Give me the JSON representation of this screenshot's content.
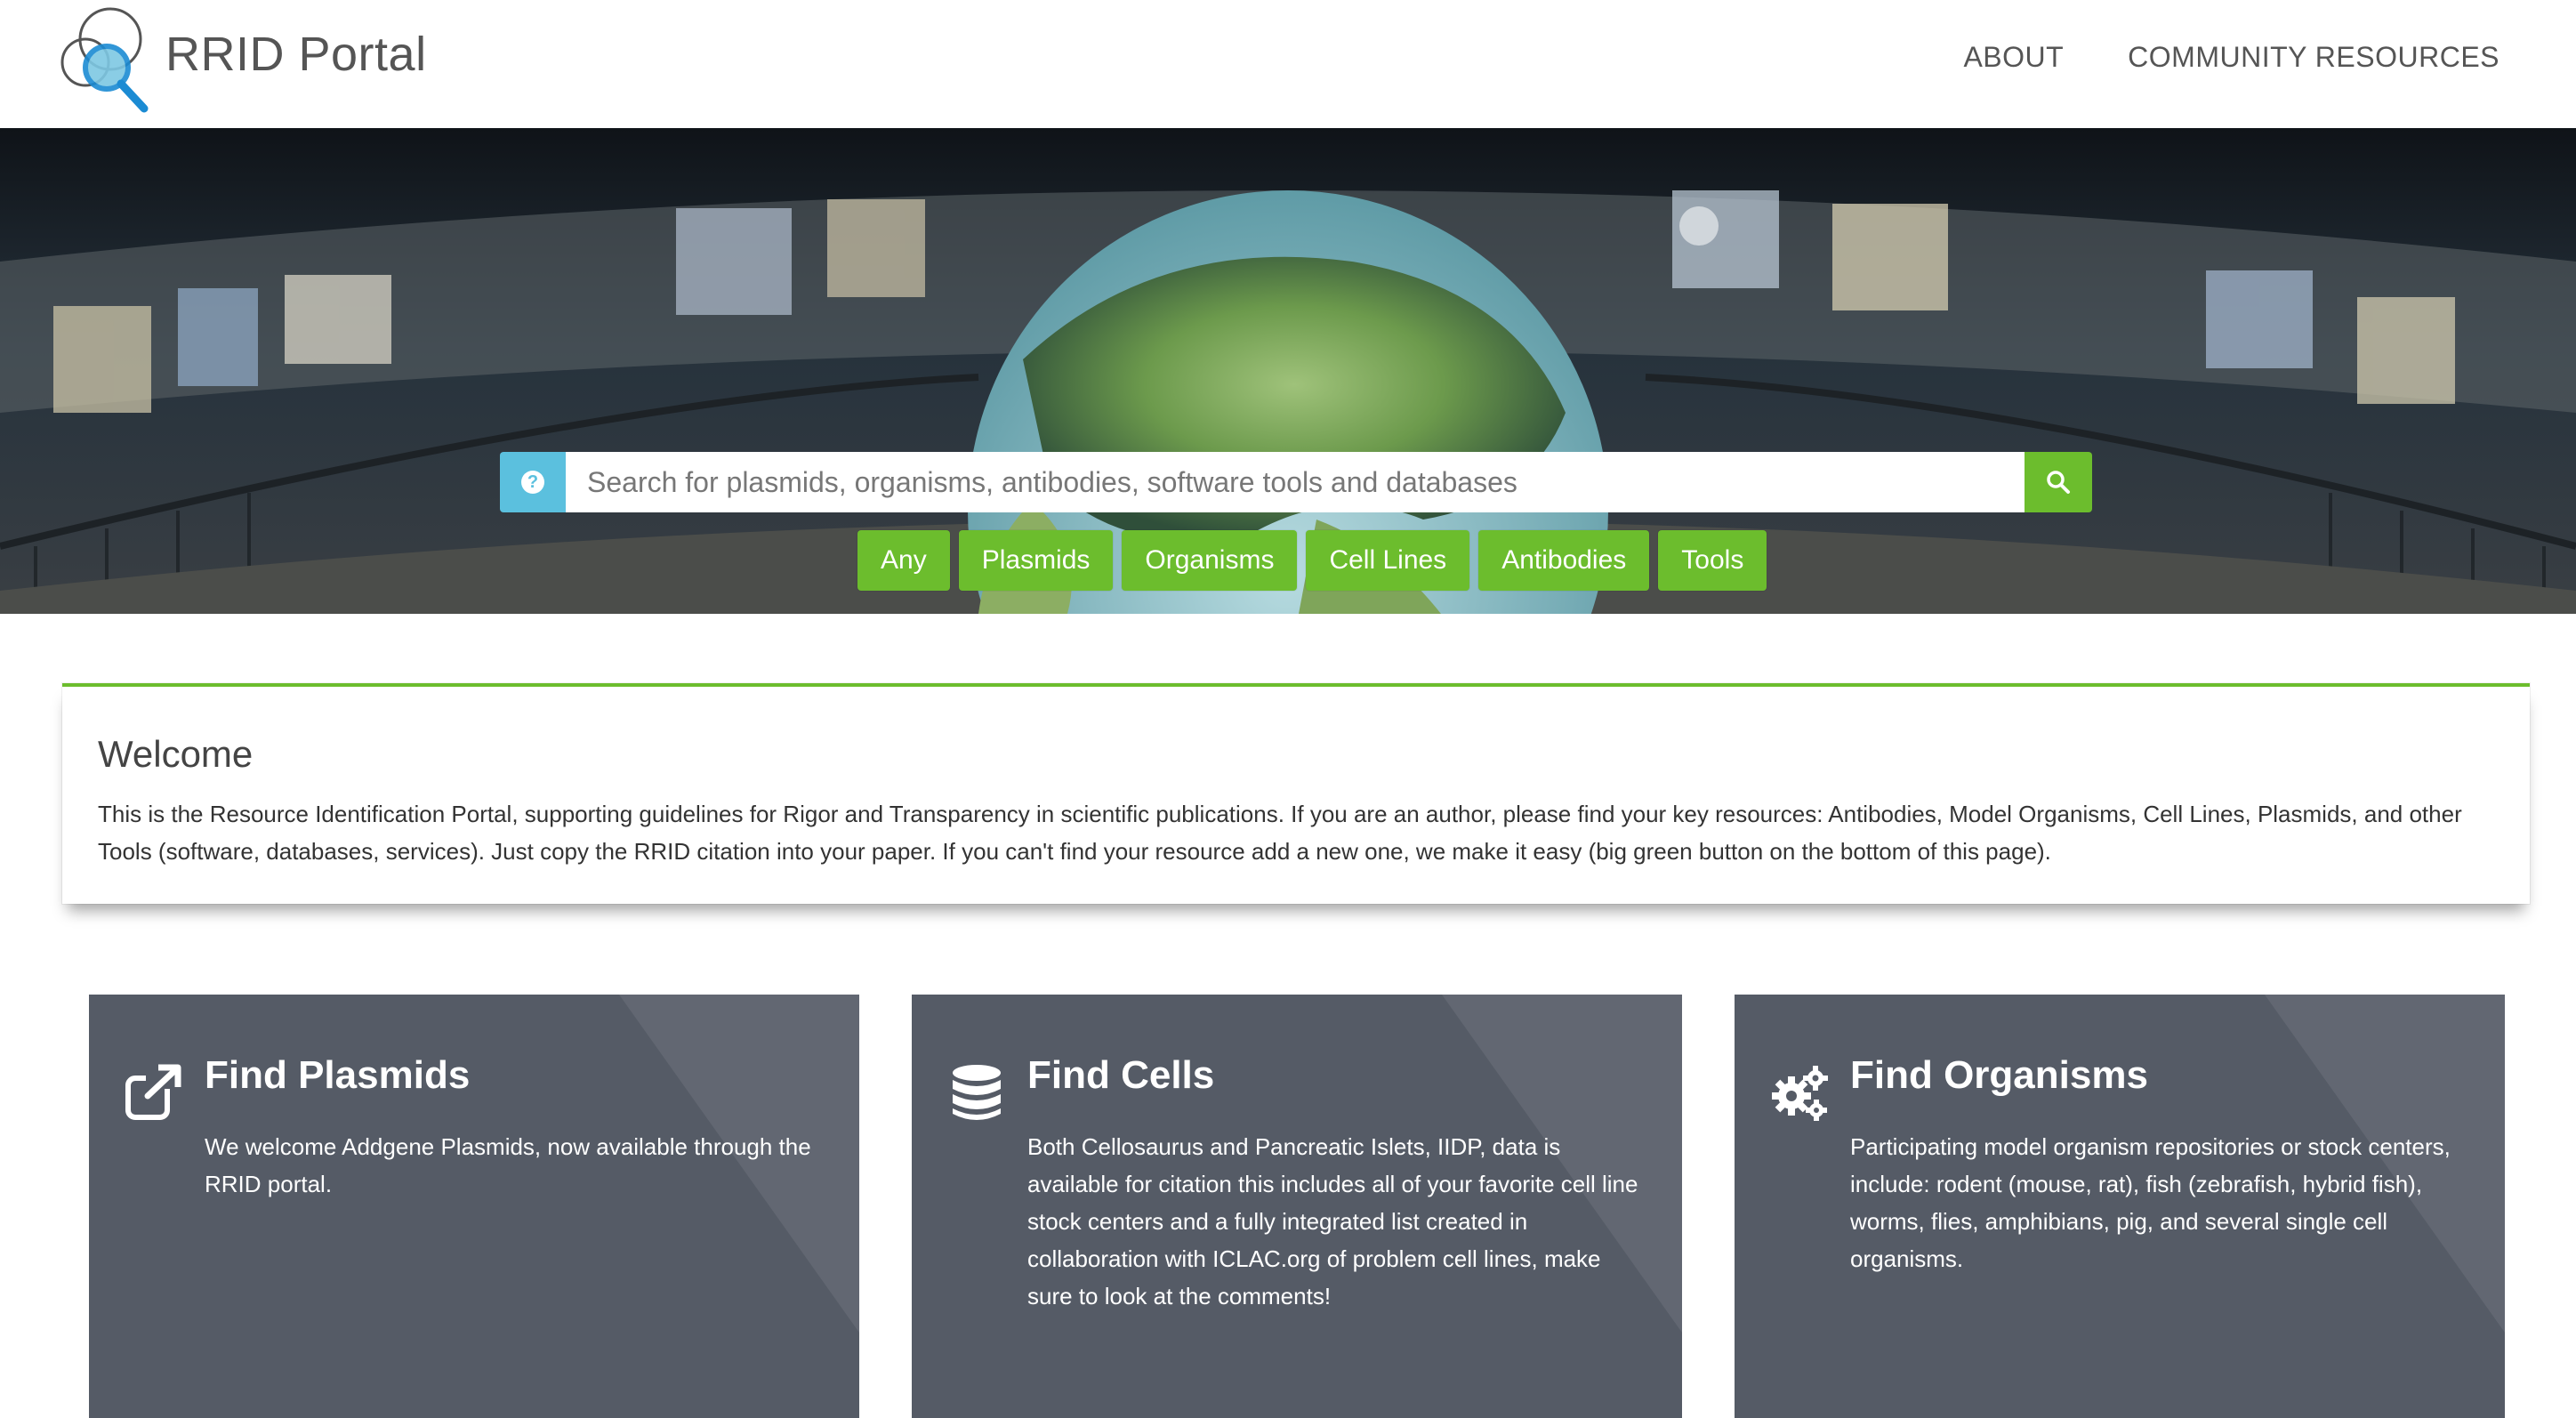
{
  "header": {
    "brand": "RRID Portal",
    "nav": [
      "ABOUT",
      "COMMUNITY RESOURCES"
    ]
  },
  "search": {
    "placeholder": "Search for plasmids, organisms, antibodies, software tools and databases",
    "help_icon": "question-circle-icon",
    "submit_icon": "search-icon",
    "filters": [
      "Any",
      "Plasmids",
      "Organisms",
      "Cell Lines",
      "Antibodies",
      "Tools"
    ]
  },
  "welcome": {
    "title": "Welcome",
    "text": "This is the Resource Identification Portal, supporting guidelines for Rigor and Transparency in scientific publications. If you are an author, please find your key resources: Antibodies, Model Organisms, Cell Lines, Plasmids, and other Tools (software, databases, services). Just copy the RRID citation into your paper. If you can't find your resource add a new one, we make it easy (big green button on the bottom of this page)."
  },
  "cards": [
    {
      "title": "Find Plasmids",
      "icon": "external-link-icon",
      "text": "We welcome Addgene Plasmids,  now available through the RRID portal."
    },
    {
      "title": "Find Cells",
      "icon": "database-icon",
      "text": "Both Cellosaurus and Pancreatic Islets, IIDP, data is available for citation this includes all of your favorite cell line stock centers and a fully integrated list created in collaboration with ICLAC.org of problem cell lines, make sure to look at the comments!"
    },
    {
      "title": "Find Organisms",
      "icon": "gears-icon",
      "text": "Participating model organism repositories or stock centers, include: rodent (mouse, rat), fish (zebrafish, hybrid fish), worms, flies, amphibians, pig, and several single cell organisms."
    }
  ],
  "colors": {
    "accent_green": "#6cbd2d",
    "info_blue": "#5bc0de",
    "card_gray": "#555b66"
  }
}
